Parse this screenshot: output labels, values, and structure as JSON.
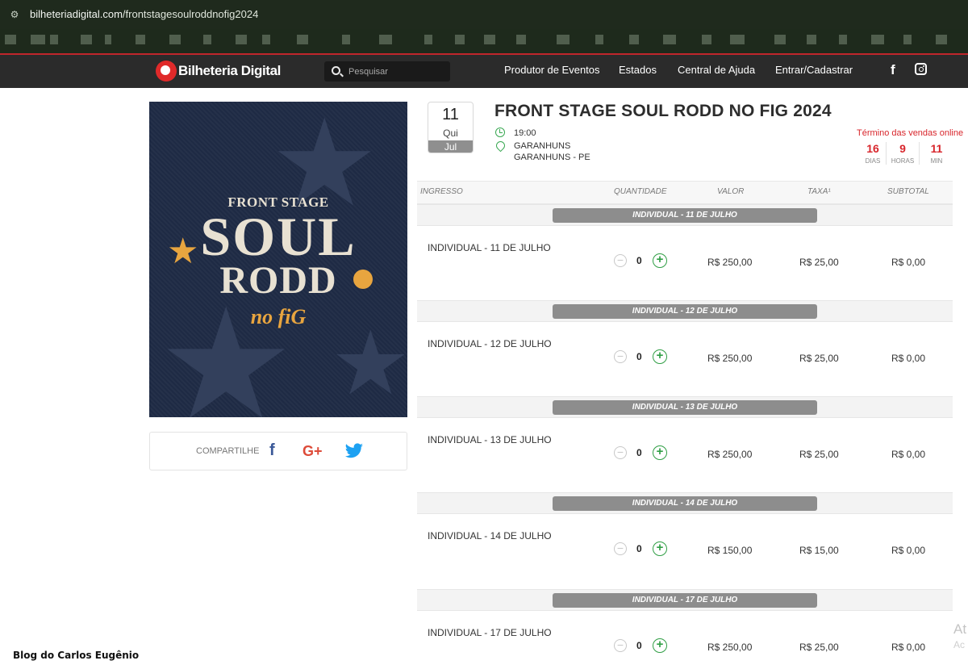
{
  "browser": {
    "url_host": "bilheteriadigital.com",
    "url_path": "/frontstagesoulroddnofig2024"
  },
  "header": {
    "logo_text": "Bilheteria Digital",
    "search_placeholder": "Pesquisar",
    "nav": [
      "Produtor de Eventos",
      "Estados",
      "Central de Ajuda",
      "Entrar/Cadastrar"
    ],
    "facebook_label": "f"
  },
  "poster": {
    "line1": "FRONT STAGE",
    "line2": "SOUL",
    "line3": "RODD",
    "line4": "no fiG"
  },
  "share": {
    "label": "COMPARTILHE",
    "facebook": "f",
    "google": "G+"
  },
  "event": {
    "day": "11",
    "weekday": "Qui",
    "month": "Jul",
    "title": "FRONT STAGE SOUL RODD NO FIG 2024",
    "time": "19:00",
    "venue": "GARANHUNS",
    "city": "GARANHUNS - PE",
    "sales_end_label": "Término das vendas online",
    "countdown": [
      {
        "value": "16",
        "unit": "DIAS"
      },
      {
        "value": "9",
        "unit": "HORAS"
      },
      {
        "value": "11",
        "unit": "MIN"
      }
    ]
  },
  "table": {
    "headers": [
      "INGRESSO",
      "QUANTIDADE",
      "VALOR",
      "TAXA¹",
      "SUBTOTAL"
    ],
    "groups": [
      {
        "band": "INDIVIDUAL - 11 DE JULHO",
        "name": "INDIVIDUAL - 11 DE JULHO",
        "qty": "0",
        "price": "R$ 250,00",
        "fee": "R$ 25,00",
        "subtotal": "R$ 0,00"
      },
      {
        "band": "INDIVIDUAL - 12 DE JULHO",
        "name": "INDIVIDUAL - 12 DE JULHO",
        "qty": "0",
        "price": "R$ 250,00",
        "fee": "R$ 25,00",
        "subtotal": "R$ 0,00"
      },
      {
        "band": "INDIVIDUAL - 13 DE JULHO",
        "name": "INDIVIDUAL - 13 DE JULHO",
        "qty": "0",
        "price": "R$ 250,00",
        "fee": "R$ 25,00",
        "subtotal": "R$ 0,00"
      },
      {
        "band": "INDIVIDUAL - 14 DE JULHO",
        "name": "INDIVIDUAL - 14 DE JULHO",
        "qty": "0",
        "price": "R$ 150,00",
        "fee": "R$ 15,00",
        "subtotal": "R$ 0,00"
      },
      {
        "band": "INDIVIDUAL - 17 DE JULHO",
        "name": "INDIVIDUAL - 17 DE JULHO",
        "qty": "0",
        "price": "R$ 250,00",
        "fee": "R$ 25,00",
        "subtotal": "R$ 0,00"
      }
    ]
  },
  "overlay": {
    "watermark": "Blog do Carlos Eugênio",
    "activate_line1": "At",
    "activate_line2": "Ac"
  },
  "colors": {
    "accent_red": "#d8262c",
    "header_bg": "#2b2b2b",
    "plus_green": "#2f9e44",
    "band_gray": "#8d8d8d"
  }
}
